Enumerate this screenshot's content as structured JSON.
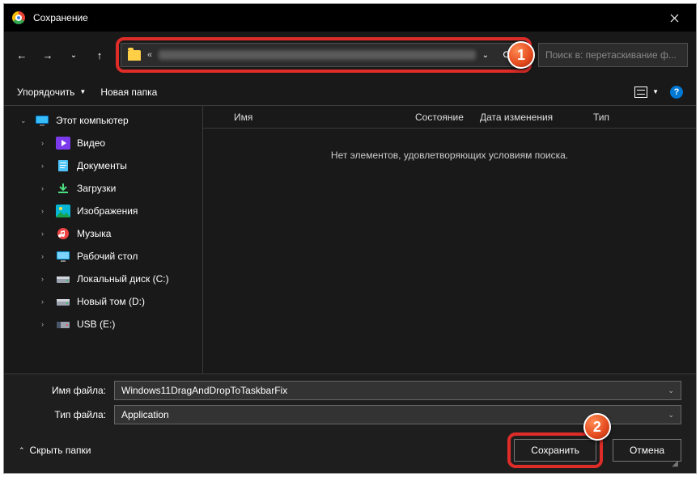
{
  "title": "Сохранение",
  "nav": {
    "back": "←",
    "forward": "→",
    "history": "⌄",
    "up": "↑",
    "refresh": "⟳",
    "path_chev": "⌄",
    "addr_prefix": "«"
  },
  "search": {
    "placeholder": "Поиск в: перетаскивание ф..."
  },
  "toolbar": {
    "organize": "Упорядочить",
    "new_folder": "Новая папка"
  },
  "columns": {
    "name": "Имя",
    "state": "Состояние",
    "date": "Дата изменения",
    "type": "Тип"
  },
  "empty": "Нет элементов, удовлетворяющих условиям поиска.",
  "sidebar": {
    "root": "Этот компьютер",
    "items": [
      {
        "label": "Видео",
        "icon": "video"
      },
      {
        "label": "Документы",
        "icon": "docs"
      },
      {
        "label": "Загрузки",
        "icon": "downloads"
      },
      {
        "label": "Изображения",
        "icon": "pictures"
      },
      {
        "label": "Музыка",
        "icon": "music"
      },
      {
        "label": "Рабочий стол",
        "icon": "desktop"
      },
      {
        "label": "Локальный диск (C:)",
        "icon": "disk"
      },
      {
        "label": "Новый том (D:)",
        "icon": "disk"
      },
      {
        "label": "USB (E:)",
        "icon": "usb"
      }
    ]
  },
  "fields": {
    "filename_label": "Имя файла:",
    "filename_value": "Windows11DragAndDropToTaskbarFix",
    "filetype_label": "Тип файла:",
    "filetype_value": "Application"
  },
  "footer": {
    "hide": "Скрыть папки",
    "save": "Сохранить",
    "cancel": "Отмена"
  },
  "markers": {
    "one": "1",
    "two": "2"
  }
}
